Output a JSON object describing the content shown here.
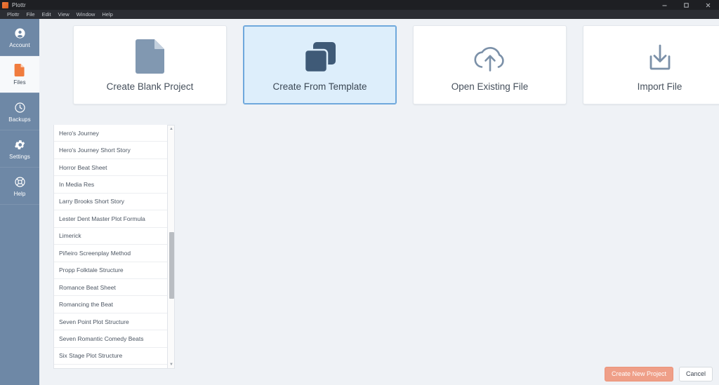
{
  "window": {
    "title": "Plottr",
    "app_icon": "plottr-logo-icon",
    "controls": [
      {
        "name": "minimize",
        "icon": "minimize-icon"
      },
      {
        "name": "maximize",
        "icon": "maximize-icon"
      },
      {
        "name": "close",
        "icon": "close-icon"
      }
    ]
  },
  "menubar": {
    "items": [
      {
        "label": "Plottr"
      },
      {
        "label": "File"
      },
      {
        "label": "Edit"
      },
      {
        "label": "View"
      },
      {
        "label": "Window"
      },
      {
        "label": "Help"
      }
    ]
  },
  "sidebar": {
    "items": [
      {
        "label": "Account",
        "icon": "user-circle-icon",
        "active": false
      },
      {
        "label": "Files",
        "icon": "file-icon",
        "active": true
      },
      {
        "label": "Backups",
        "icon": "clock-icon",
        "active": false
      },
      {
        "label": "Settings",
        "icon": "gear-icon",
        "active": false
      },
      {
        "label": "Help",
        "icon": "life-ring-icon",
        "active": false
      }
    ]
  },
  "cards": [
    {
      "label": "Create Blank Project",
      "icon": "document-icon",
      "selected": false
    },
    {
      "label": "Create From Template",
      "icon": "copy-stack-icon",
      "selected": true
    },
    {
      "label": "Open Existing File",
      "icon": "cloud-upload-icon",
      "selected": false
    },
    {
      "label": "Import File",
      "icon": "import-tray-icon",
      "selected": false
    }
  ],
  "template_list": {
    "items": [
      "Hero's Journey",
      "Hero's Journey Short Story",
      "Horror Beat Sheet",
      "In Media Res",
      "Larry Brooks Short Story",
      "Lester Dent Master Plot Formula",
      "Limerick",
      "Piñeiro Screenplay Method",
      "Propp Folktale Structure",
      "Romance Beat Sheet",
      "Romancing the Beat",
      "Seven Point Plot Structure",
      "Seven Romantic Comedy Beats",
      "Six Stage Plot Structure"
    ],
    "scrollbar": {
      "up_arrow": "▲",
      "down_arrow": "▼"
    }
  },
  "footer": {
    "create_label": "Create New Project",
    "cancel_label": "Cancel"
  },
  "colors": {
    "sidebar": "#6e88a6",
    "accent_orange": "#f07c3e",
    "selected_card_bg": "#ddeefb",
    "selected_card_border": "#6fa8dc",
    "primary_button": "#f09b83",
    "icon_slate": "#7b90a8",
    "canvas": "#eff2f6"
  }
}
